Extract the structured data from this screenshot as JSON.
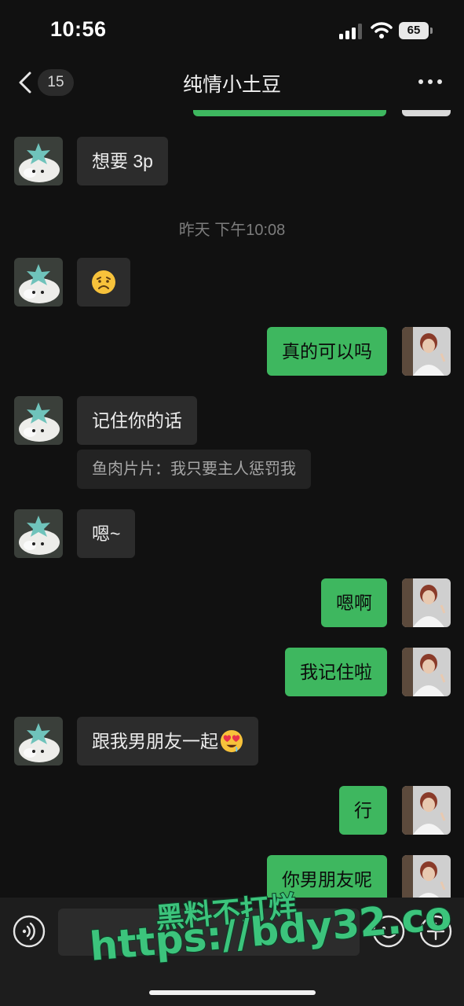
{
  "status_bar": {
    "time": "10:56",
    "battery": "65"
  },
  "nav": {
    "back_count": "15",
    "title": "纯情小土豆"
  },
  "messages": [
    {
      "side": "in",
      "text": "想要 3p"
    },
    {
      "side": "in",
      "emoji": "disappointed-face"
    },
    {
      "side": "out",
      "text": "真的可以吗"
    },
    {
      "side": "in",
      "text": "记住你的话",
      "quote": "鱼肉片片：我只要主人惩罚我"
    },
    {
      "side": "in",
      "text": "嗯~"
    },
    {
      "side": "out",
      "text": "嗯啊"
    },
    {
      "side": "out",
      "text": "我记住啦"
    },
    {
      "side": "in",
      "text": "跟我男朋友一起",
      "emoji": "heart-eyes-face"
    },
    {
      "side": "out",
      "text": "行"
    },
    {
      "side": "out",
      "text": "你男朋友呢"
    }
  ],
  "timestamp": "昨天 下午10:08",
  "input": {
    "placeholder": ""
  },
  "watermark": {
    "line1": "黑料不打烊",
    "line2": "https://bdy32.co"
  },
  "colors": {
    "background": "#111111",
    "incoming_bubble": "#2c2c2c",
    "outgoing_bubble": "#3eb75f",
    "watermark": "#3cc47c"
  }
}
